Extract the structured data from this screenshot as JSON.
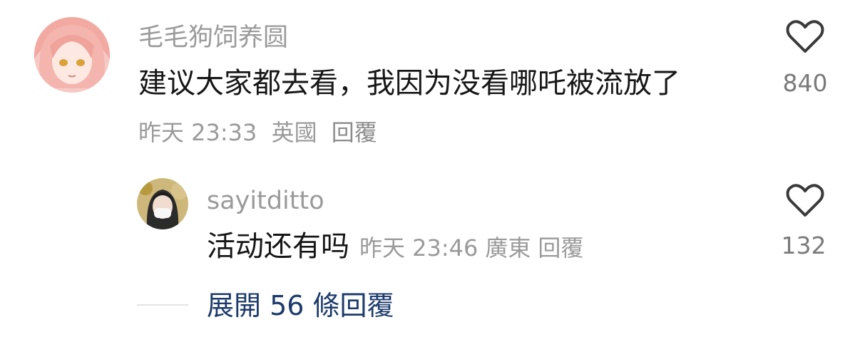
{
  "comments": [
    {
      "username": "毛毛狗饲养圆",
      "text": "建议大家都去看，我因为没看哪吒被流放了",
      "time": "昨天 23:33",
      "location": "英國",
      "reply_label": "回覆",
      "likes": "840",
      "avatar_icon": "anime-avatar"
    }
  ],
  "replies": [
    {
      "username": "sayitditto",
      "text": "活动还有吗",
      "time": "昨天 23:46",
      "location": "廣東",
      "reply_label": "回覆",
      "likes": "132",
      "avatar_icon": "person-avatar"
    }
  ],
  "expand_replies": {
    "label": "展開 56 條回覆"
  },
  "icons": {
    "like": "heart-outline-icon"
  },
  "colors": {
    "expand_link": "#1c3a6b",
    "secondary_text": "#9a9a9a"
  }
}
